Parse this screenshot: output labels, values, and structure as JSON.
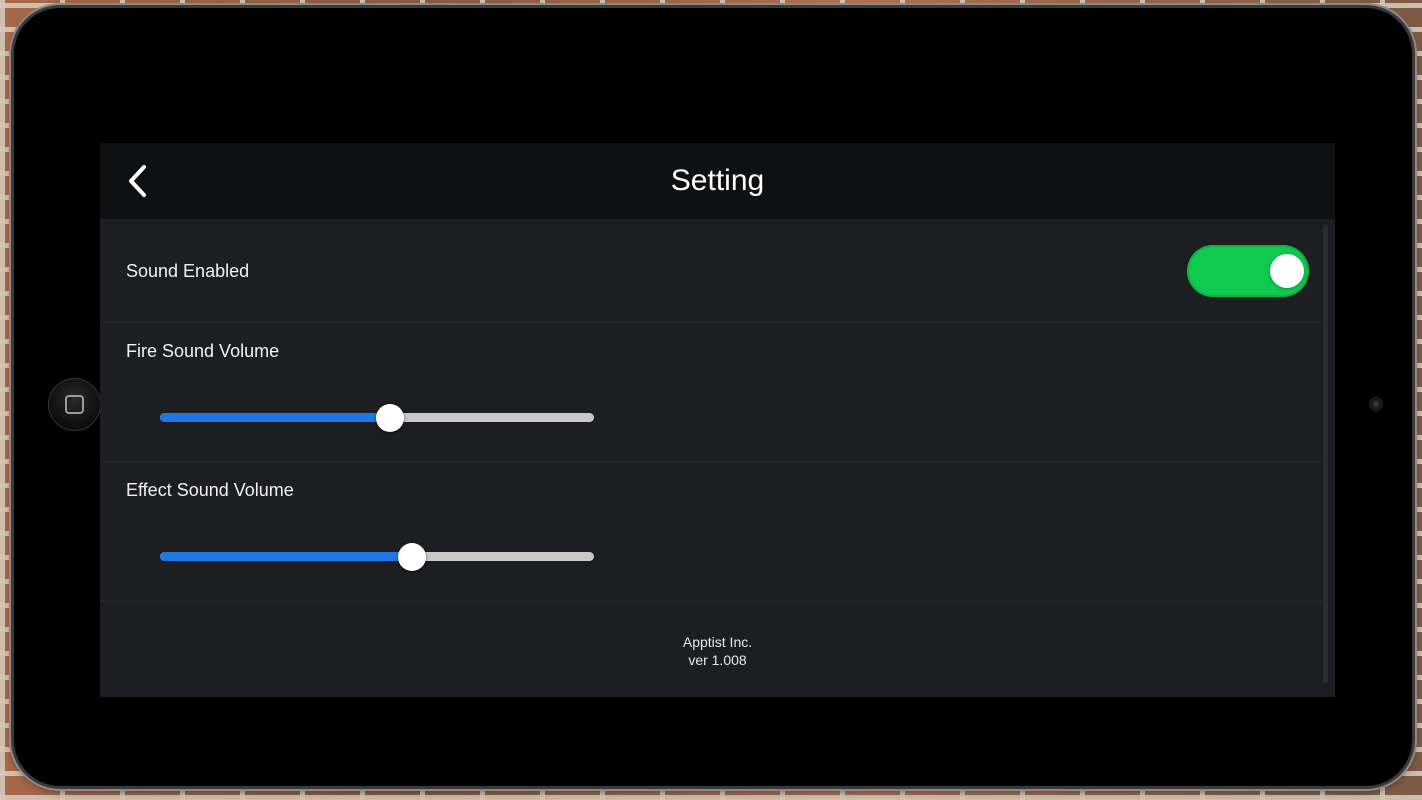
{
  "header": {
    "title": "Setting",
    "back_icon": "chevron-left-icon"
  },
  "settings": {
    "sound_enabled": {
      "label": "Sound Enabled",
      "on": true,
      "color": "#10c94f"
    },
    "fire_volume": {
      "label": "Fire Sound Volume",
      "value": 0.53
    },
    "effect_volume": {
      "label": "Effect Sound Volume",
      "value": 0.58
    },
    "slider_fill_color": "#1f77e6"
  },
  "footer": {
    "company": "Apptist Inc.",
    "version": "ver 1.008"
  }
}
